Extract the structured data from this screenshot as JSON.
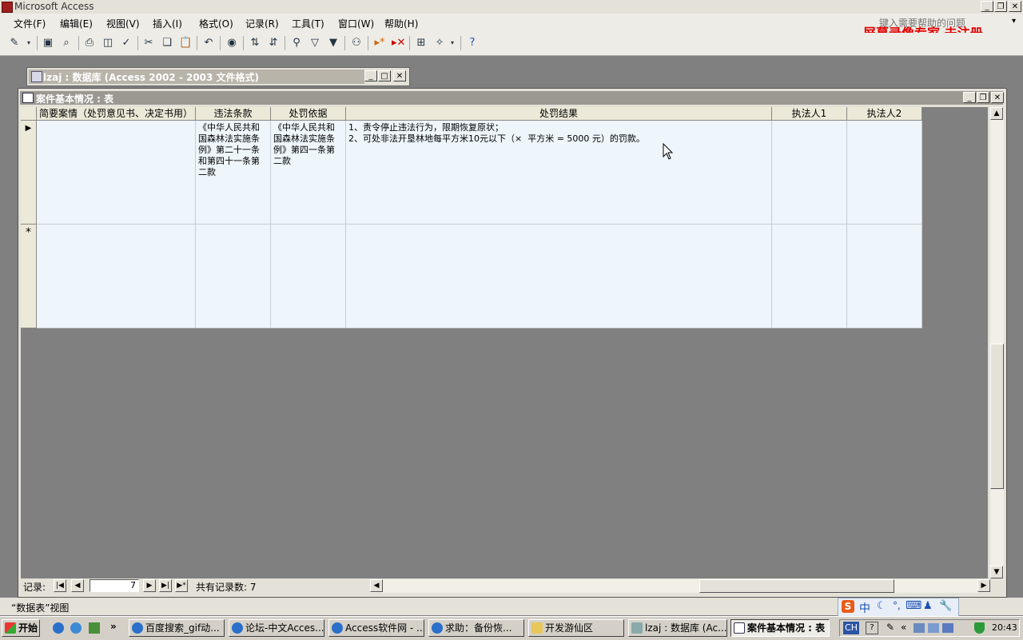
{
  "app": {
    "title": "Microsoft Access"
  },
  "menu": {
    "items": [
      "文件(F)",
      "编辑(E)",
      "视图(V)",
      "插入(I)",
      "格式(O)",
      "记录(R)",
      "工具(T)",
      "窗口(W)",
      "帮助(H)"
    ],
    "help_placeholder": "键入需要帮助的问题",
    "watermark": "屏幕录像专家  未注册"
  },
  "toolbar": {
    "icons": [
      "view-icon",
      "save-icon",
      "file-search-icon",
      "print-icon",
      "print-preview-icon",
      "spelling-icon",
      "cut-icon",
      "copy-icon",
      "paste-icon",
      "undo-icon",
      "hyperlink-icon",
      "sort-ascending-icon",
      "sort-descending-icon",
      "filter-by-selection-icon",
      "filter-by-form-icon",
      "apply-filter-icon",
      "find-icon",
      "new-record-icon",
      "delete-record-icon",
      "database-window-icon",
      "new-object-icon",
      "help-icon"
    ]
  },
  "db_window": {
    "title": "lzaj : 数据库 (Access 2002 - 2003 文件格式)"
  },
  "table_window": {
    "title": "案件基本情况 : 表",
    "columns": [
      "简要案情（处罚意见书、决定书用）",
      "违法条款",
      "处罚依据",
      "处罚结果",
      "执法人1",
      "执法人2"
    ],
    "rows": [
      {
        "cells": [
          "",
          "《中华人民共和国森林法实施条例》第二十一条和第四十一条第二款",
          "《中华人民共和国森林法实施条例》第四一条第二款",
          "1、责令停止违法行为，限期恢复原状；\n2、可处非法开垦林地每平方米10元以下（×  平方米 = 5000 元）的罚款。",
          "",
          ""
        ]
      }
    ],
    "new_row_marker": "*",
    "current_row_marker": "▶"
  },
  "record_nav": {
    "label": "记录:",
    "current": "7",
    "total_label": "共有记录数: 7"
  },
  "status": {
    "text": "“数据表”视图"
  },
  "ime": {
    "items": [
      "S",
      "中",
      "☾",
      "°,",
      "⌨",
      "♟",
      "🔧"
    ]
  },
  "taskbar": {
    "start": "开始",
    "tasks": [
      "百度搜索_gif动...",
      "论坛-中文Acces...",
      "Access软件网 - ...",
      "求助：备份恢...",
      "开发游仙区",
      "lzaj : 数据库 (Ac...",
      "案件基本情况 : 表"
    ],
    "lang": "CH",
    "clock": "20:43"
  },
  "colors": {
    "cell_bg": "#eef5fb",
    "watermark": "#e00000"
  }
}
